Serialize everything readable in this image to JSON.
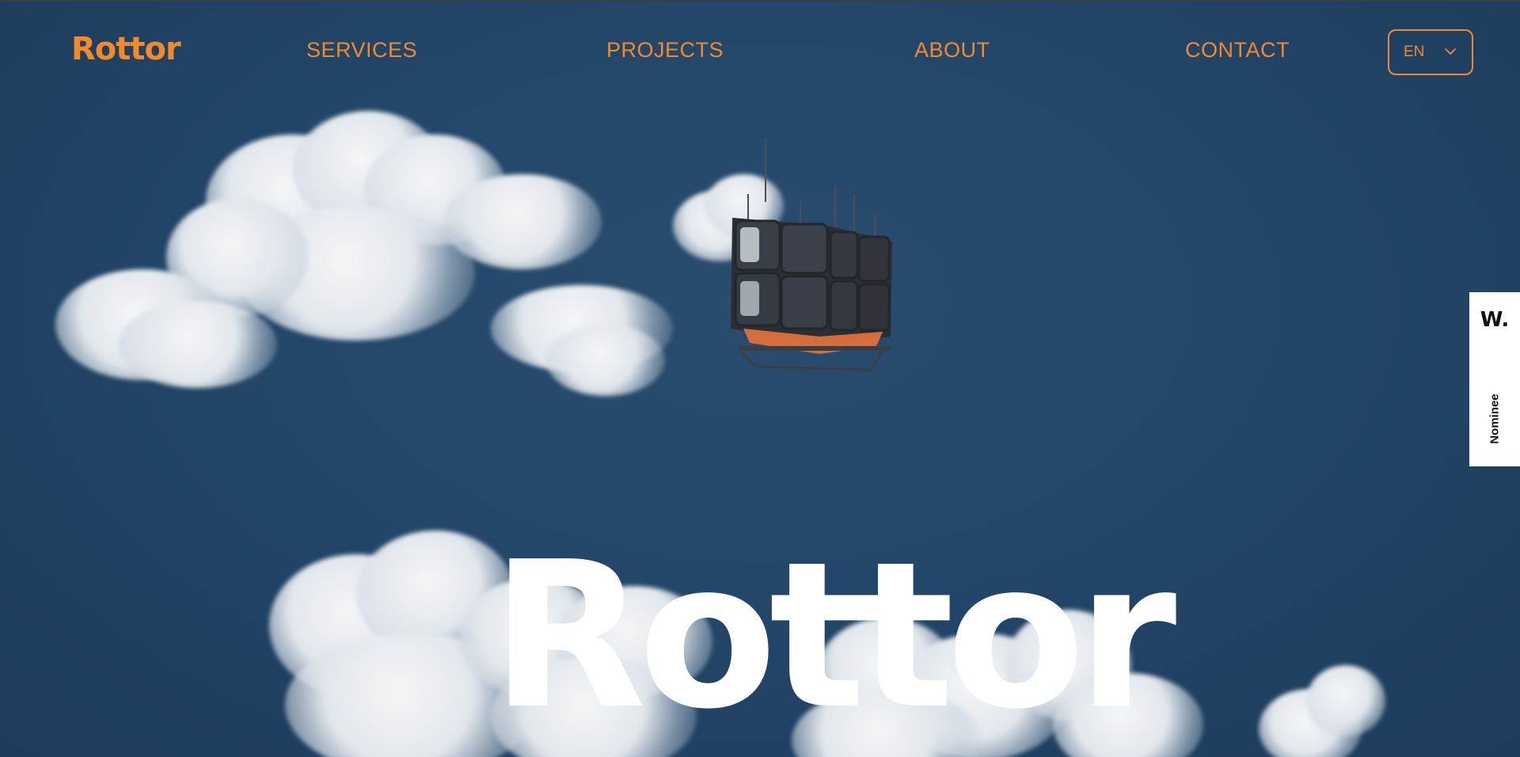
{
  "brand": {
    "logo_text": "Rottor"
  },
  "nav": {
    "items": [
      {
        "label": "SERVICES"
      },
      {
        "label": "PROJECTS"
      },
      {
        "label": "ABOUT"
      },
      {
        "label": "CONTACT"
      }
    ]
  },
  "language_selector": {
    "selected": "EN",
    "icon": "chevron-down-icon"
  },
  "hero": {
    "title": "Rottor",
    "image": "floating-modular-pod-in-cloudy-sky"
  },
  "award_badge": {
    "logo_text": "W.",
    "label": "Nominee"
  },
  "colors": {
    "accent": "#f08a2c",
    "sky": "#23466a",
    "title": "#ffffff"
  }
}
